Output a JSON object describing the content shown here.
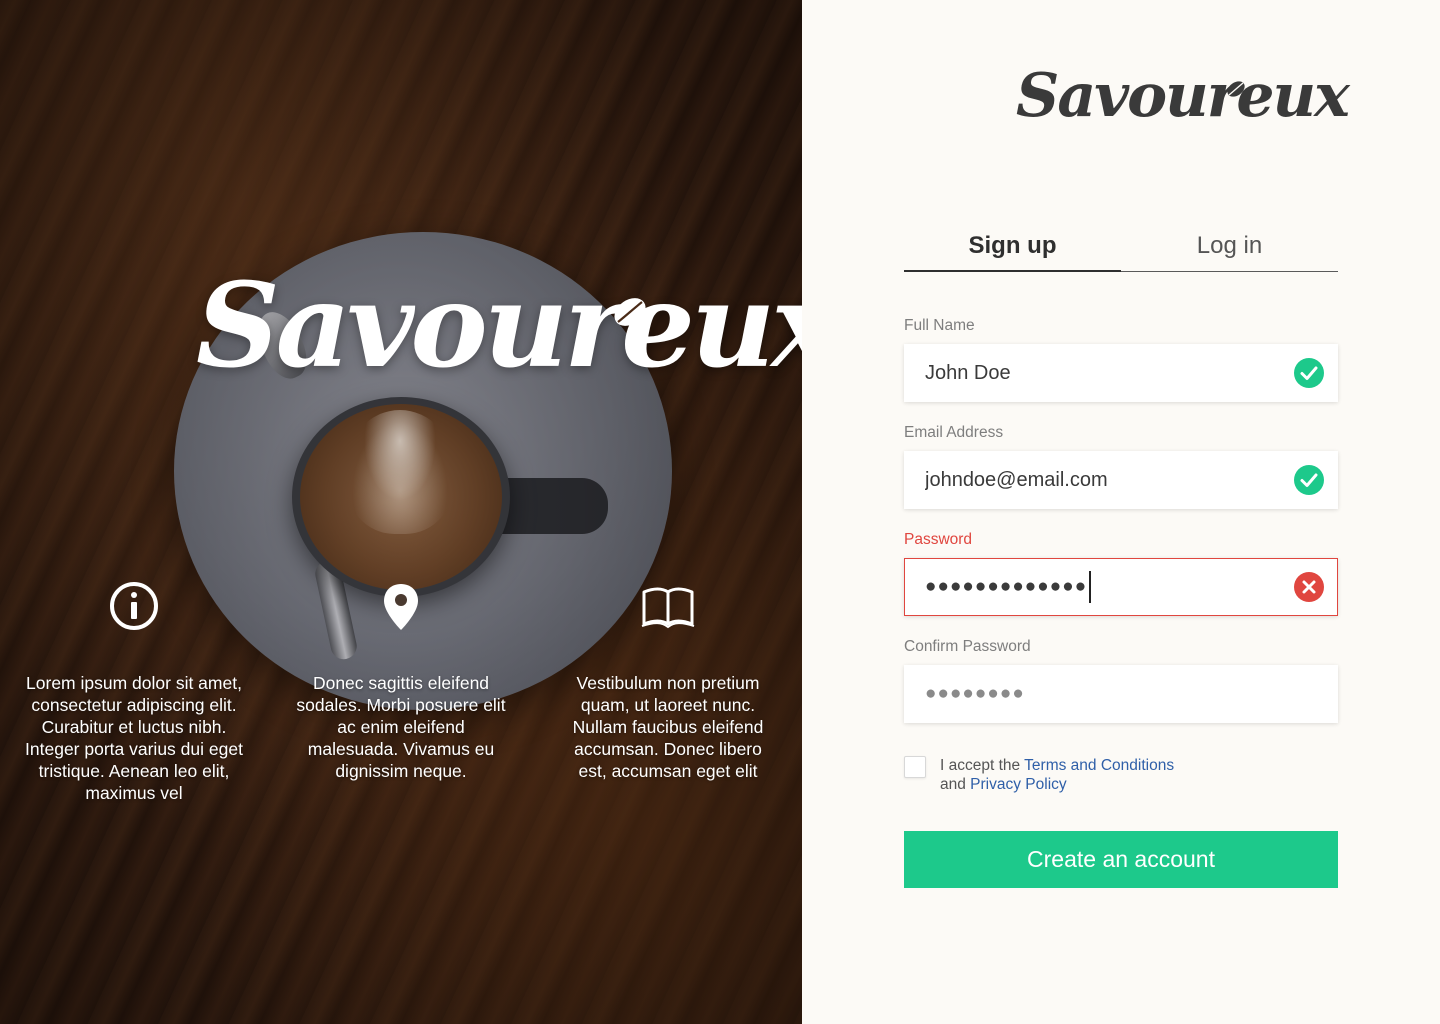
{
  "brand": {
    "name": "Savoureux"
  },
  "hero": {
    "logo_text": "Savoureux",
    "features": [
      {
        "icon": "info-icon",
        "text": "Lorem ipsum dolor sit amet, consectetur adipiscing elit. Curabitur et luctus nibh. Integer porta varius dui eget tristique. Aenean leo elit, maximus vel"
      },
      {
        "icon": "location-pin-icon",
        "text": "Donec sagittis eleifend sodales. Morbi posuere elit ac enim eleifend malesuada. Vivamus eu dignissim neque."
      },
      {
        "icon": "book-icon",
        "text": "Vestibulum non pretium quam, ut laoreet nunc. Nullam faucibus eleifend accumsan. Donec libero est, accumsan eget elit"
      }
    ]
  },
  "tabs": {
    "signup": "Sign up",
    "login": "Log in"
  },
  "form": {
    "full_name": {
      "label": "Full Name",
      "value": "John Doe",
      "status": "valid"
    },
    "email": {
      "label": "Email Address",
      "value": "johndoe@email.com",
      "status": "valid"
    },
    "password": {
      "label": "Password",
      "value_masked": "●●●●●●●●●●●●●",
      "status": "invalid"
    },
    "confirm_password": {
      "label": "Confirm Password",
      "value_masked": "●●●●●●●●"
    },
    "terms": {
      "prefix": "I accept the ",
      "terms_link": "Terms and Conditions",
      "middle": "and ",
      "privacy_link": "Privacy Policy",
      "checked": false
    },
    "submit_label": "Create an account"
  },
  "colors": {
    "accent": "#1dc98b",
    "valid": "#1dc98b",
    "error": "#e0463f",
    "link": "#2f5fa8",
    "panel_bg": "#fcfaf6"
  }
}
